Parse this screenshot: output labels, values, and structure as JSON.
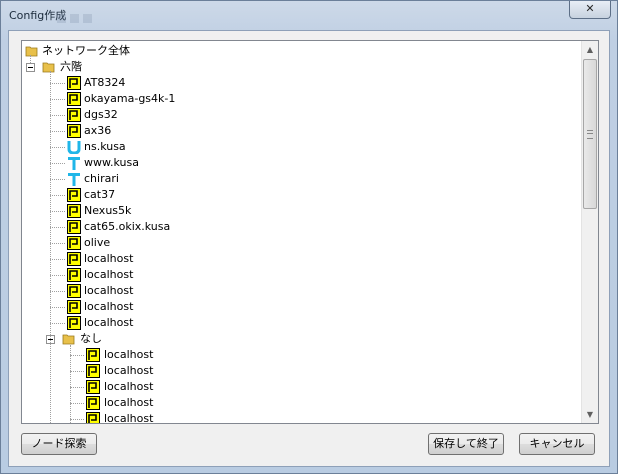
{
  "window": {
    "title": "Config作成",
    "close_symbol": "✕"
  },
  "tree": {
    "root": "ネットワーク全体",
    "group": "六階",
    "devices": [
      {
        "label": "AT8324",
        "icon": "router-flag-icon"
      },
      {
        "label": "okayama-gs4k-1",
        "icon": "router-flag-icon"
      },
      {
        "label": "dgs32",
        "icon": "router-flag-icon"
      },
      {
        "label": "ax36",
        "icon": "router-flag-icon"
      },
      {
        "label": "ns.kusa",
        "icon": "unix-u-icon"
      },
      {
        "label": "www.kusa",
        "icon": "unix-t-icon"
      },
      {
        "label": "chirari",
        "icon": "unix-t-icon"
      },
      {
        "label": "cat37",
        "icon": "router-flag-icon"
      },
      {
        "label": "Nexus5k",
        "icon": "router-flag-icon"
      },
      {
        "label": "cat65.okix.kusa",
        "icon": "router-flag-icon"
      },
      {
        "label": "olive",
        "icon": "router-flag-icon"
      },
      {
        "label": "localhost",
        "icon": "router-flag-icon"
      },
      {
        "label": "localhost",
        "icon": "router-flag-icon"
      },
      {
        "label": "localhost",
        "icon": "router-flag-icon"
      },
      {
        "label": "localhost",
        "icon": "router-flag-icon"
      },
      {
        "label": "localhost",
        "icon": "router-flag-icon"
      }
    ],
    "subgroup": "なし",
    "subdevices": [
      {
        "label": "localhost",
        "icon": "router-flag-icon"
      },
      {
        "label": "localhost",
        "icon": "router-flag-icon"
      },
      {
        "label": "localhost",
        "icon": "router-flag-icon"
      },
      {
        "label": "localhost",
        "icon": "router-flag-icon"
      },
      {
        "label": "localhost",
        "icon": "router-flag-icon"
      }
    ]
  },
  "buttons": {
    "node_search": "ノード探索",
    "save_exit": "保存して終了",
    "cancel": "キャンセル"
  },
  "colors": {
    "flag_yellow": "#ffff00",
    "unix_cyan": "#1fb6e8",
    "folder_yellow": "#e8c04a"
  }
}
